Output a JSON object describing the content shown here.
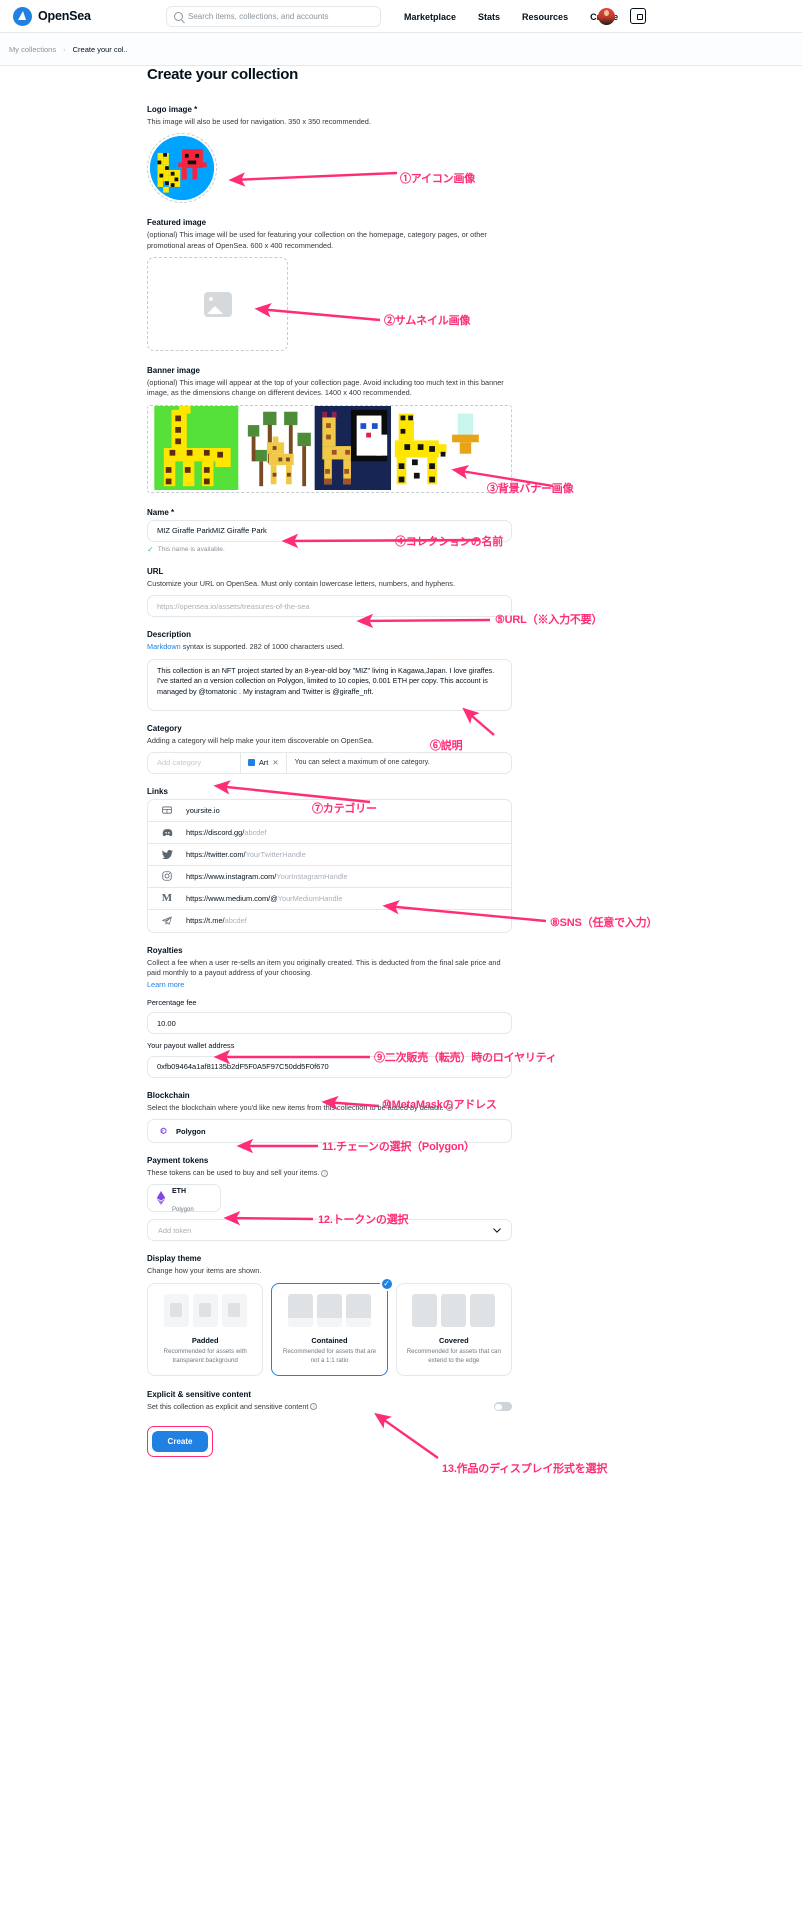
{
  "header": {
    "brand": "OpenSea",
    "search_placeholder": "Search items, collections, and accounts",
    "nav": [
      "Marketplace",
      "Stats",
      "Resources",
      "Create"
    ],
    "avatar_name": "user-avatar",
    "wallet_icon": "wallet-icon"
  },
  "breadcrumb": {
    "root": "My collections",
    "separator": "›",
    "current": "Create your col.."
  },
  "page_title": "Create your collection",
  "logo_image": {
    "label": "Logo image *",
    "hint": "This image will also be used for navigation. 350 x 350 recommended."
  },
  "featured_image": {
    "label": "Featured image",
    "hint": "(optional) This image will be used for featuring your collection on the homepage, category pages, or other promotional areas of OpenSea. 600 x 400 recommended."
  },
  "banner_image": {
    "label": "Banner image",
    "hint": "(optional) This image will appear at the top of your collection page. Avoid including too much text in this banner image, as the dimensions change on different devices. 1400 x 400 recommended."
  },
  "name": {
    "label": "Name *",
    "value": "MIZ Giraffe ParkMIZ Giraffe Park",
    "available_text": "This name is available."
  },
  "url": {
    "label": "URL",
    "hint": "Customize your URL on OpenSea. Must only contain lowercase letters, numbers, and hyphens.",
    "placeholder": "https://opensea.io/assets/treasures-of-the-sea"
  },
  "description": {
    "label": "Description",
    "hint_link": "Markdown",
    "hint_rest": " syntax is supported. 282 of 1000 characters used.",
    "value": "This collection is an NFT project started by an 8-year-old boy \"MIZ\" living in Kagawa,Japan. I love giraffes. I've started an α version collection on Polygon, limited to 10 copies, 0.001 ETH per copy. This account is managed by @tomatonic . My instagram and Twitter is @giraffe_nft."
  },
  "category": {
    "label": "Category",
    "hint": "Adding a category will help make your item discoverable on OpenSea.",
    "add_placeholder": "Add category",
    "chip": "Art",
    "note": "You can select a maximum of one category."
  },
  "links": {
    "label": "Links",
    "rows": [
      {
        "icon": "website-icon",
        "text": "yoursite.io",
        "dim": ""
      },
      {
        "icon": "discord-icon",
        "text": "https://discord.gg/",
        "dim": "abcdef"
      },
      {
        "icon": "twitter-icon",
        "text": "https://twitter.com/",
        "dim": "YourTwitterHandle"
      },
      {
        "icon": "instagram-icon",
        "text": "https://www.instagram.com/",
        "dim": "YourInstagramHandle"
      },
      {
        "icon": "medium-icon",
        "text": "https://www.medium.com/@",
        "dim": "YourMediumHandle"
      },
      {
        "icon": "telegram-icon",
        "text": "https://t.me/",
        "dim": "abcdef"
      }
    ]
  },
  "royalties": {
    "label": "Royalties",
    "hint": "Collect a fee when a user re-sells an item you originally created. This is deducted from the final sale price and paid monthly to a payout address of your choosing.",
    "learn_more": "Learn more",
    "fee_label": "Percentage fee",
    "fee_value": "10.00",
    "payout_label": "Your payout wallet address",
    "payout_value": "0xfb09464a1af81135b2dF5F0A5F97C50dd5F0f670"
  },
  "blockchain": {
    "label": "Blockchain",
    "hint": "Select the blockchain where you'd like new items from this collection to be added by default.",
    "selected": "Polygon"
  },
  "payment_tokens": {
    "label": "Payment tokens",
    "hint": "These tokens can be used to buy and sell your items.",
    "token_name": "ETH",
    "token_chain": "Polygon",
    "add_token_placeholder": "Add token"
  },
  "display_theme": {
    "label": "Display theme",
    "hint": "Change how your items are shown.",
    "options": [
      {
        "name": "Padded",
        "desc": "Recommended for assets with transparent background",
        "selected": false
      },
      {
        "name": "Contained",
        "desc": "Recommended for assets that are not a 1:1 ratio",
        "selected": true
      },
      {
        "name": "Covered",
        "desc": "Recommended for assets that can extend to the edge",
        "selected": false
      }
    ]
  },
  "explicit": {
    "label": "Explicit & sensitive content",
    "hint": "Set this collection as explicit and sensitive content",
    "toggle_on": false
  },
  "create_button": "Create",
  "annotations": [
    {
      "id": 1,
      "text": "①アイコン画像"
    },
    {
      "id": 2,
      "text": "②サムネイル画像"
    },
    {
      "id": 3,
      "text": "③背景バナー画像"
    },
    {
      "id": 4,
      "text": "④コレクションの名前"
    },
    {
      "id": 5,
      "text": "⑤URL（※入力不要）"
    },
    {
      "id": 6,
      "text": "⑥説明"
    },
    {
      "id": 7,
      "text": "⑦カテゴリー"
    },
    {
      "id": 8,
      "text": "⑧SNS（任意で入力）"
    },
    {
      "id": 9,
      "text": "⑨二次販売（転売）時のロイヤリティ"
    },
    {
      "id": 10,
      "text": "⑩MetaMaskのアドレス"
    },
    {
      "id": 11,
      "text": "11.チェーンの選択（Polygon）"
    },
    {
      "id": 12,
      "text": "12.トークンの選択"
    },
    {
      "id": 13,
      "text": "13.作品のディスプレイ形式を選択"
    }
  ],
  "colors": {
    "accent": "#2081e2",
    "annotation": "#ff2d78",
    "success": "#34c77b",
    "muted": "#8a939b"
  }
}
